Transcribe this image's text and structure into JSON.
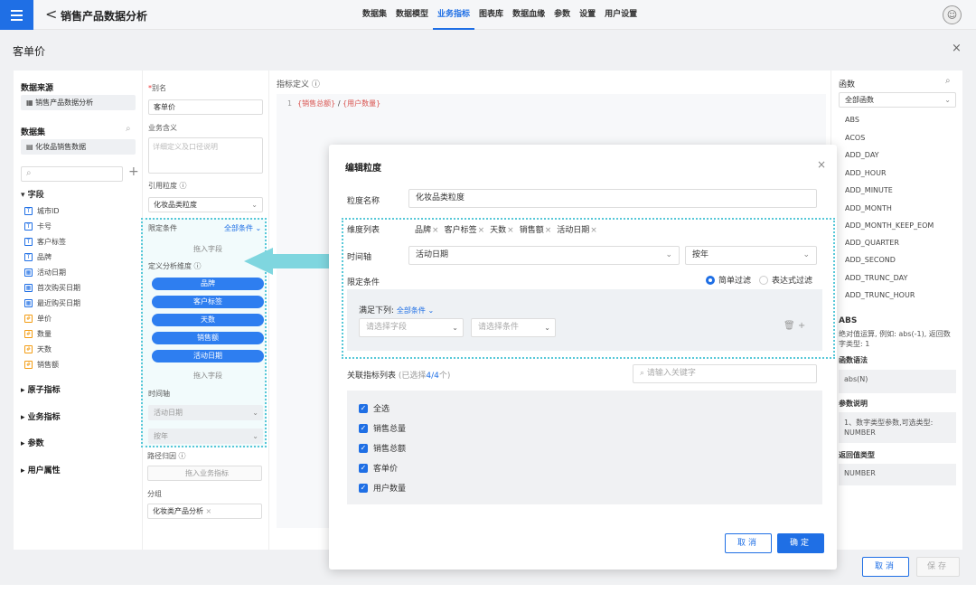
{
  "topbar": {
    "back": "<",
    "title": "销售产品数据分析",
    "nav": [
      "数据集",
      "数据模型",
      "业务指标",
      "图表库",
      "数据血缘",
      "参数",
      "设置",
      "用户设置"
    ],
    "active_nav": "业务指标",
    "avatar": "☺"
  },
  "dialog": {
    "title": "客单价",
    "close": "×"
  },
  "left": {
    "source_title": "数据来源",
    "source_value": "销售产品数据分析",
    "dataset_title": "数据集",
    "dataset_value": "化妆品销售数据",
    "fields_title": "字段",
    "fields": [
      "城市ID",
      "卡号",
      "客户标签",
      "品牌",
      "活动日期",
      "首次购买日期",
      "最近购买日期",
      "单价",
      "数量",
      "天数",
      "销售额"
    ],
    "groups": [
      "原子指标",
      "业务指标",
      "参数",
      "用户属性"
    ]
  },
  "mid": {
    "alias_label": "别名",
    "alias_value": "客单价",
    "meaning_label": "业务含义",
    "meaning_placeholder": "详细定义及口径说明",
    "granularity_label": "引用粒度",
    "granularity_value": "化妆品类粒度",
    "limit_label": "限定条件",
    "limit_link": "全部条件",
    "drop_hint": "拖入字段",
    "dims_label": "定义分析维度",
    "dims": [
      "品牌",
      "客户标签",
      "天数",
      "销售额",
      "活动日期"
    ],
    "drop_hint2": "拖入字段",
    "time_label": "时间轴",
    "time_value": "活动日期",
    "time_unit": "按年",
    "path_label": "路径归因",
    "path_hint": "拖入业务指标",
    "group_label": "分组",
    "group_value": "化妆类产品分析"
  },
  "editor": {
    "label": "指标定义",
    "line_no": "1",
    "expr_a": "{销售总额}",
    "expr_op": " / ",
    "expr_b": "{用户数量}"
  },
  "right": {
    "title": "函数",
    "select": "全部函数",
    "functions": [
      "ABS",
      "ACOS",
      "ADD_DAY",
      "ADD_HOUR",
      "ADD_MINUTE",
      "ADD_MONTH",
      "ADD_MONTH_KEEP_EOM",
      "ADD_QUARTER",
      "ADD_SECOND",
      "ADD_TRUNC_DAY",
      "ADD_TRUNC_HOUR"
    ],
    "fn_name": "ABS",
    "fn_desc": "绝对值运算, 例如: abs(-1), 返回数字类型: 1",
    "syntax_title": "函数语法",
    "syntax": "abs(N)",
    "param_title": "参数说明",
    "param": "1、数字类型参数,可选类型: NUMBER",
    "return_title": "返回值类型",
    "return": "NUMBER"
  },
  "footer": {
    "cancel": "取消",
    "save": "保存"
  },
  "modal": {
    "title": "编辑粒度",
    "close": "×",
    "name_label": "粒度名称",
    "name_value": "化妆品类粒度",
    "dim_label": "维度列表",
    "dims": [
      "品牌",
      "客户标签",
      "天数",
      "销售额",
      "活动日期"
    ],
    "time_label": "时间轴",
    "time_value": "活动日期",
    "time_unit": "按年",
    "limit_label": "限定条件",
    "radio_simple": "简单过滤",
    "radio_expr": "表达式过滤",
    "cond_label": "满足下列:",
    "cond_link": "全部条件",
    "field_placeholder": "请选择字段",
    "cond_placeholder": "请选择条件",
    "rel_label": "关联指标列表",
    "rel_count_pre": "(已选择",
    "rel_count": "4/4",
    "rel_count_post": "个)",
    "kw_placeholder": "请输入关键字",
    "checks": [
      "全选",
      "销售总量",
      "销售总额",
      "客单价",
      "用户数量"
    ],
    "cancel": "取消",
    "ok": "确定"
  },
  "colors": {
    "accent": "#1f6fe5",
    "highlight": "#57c8d8"
  }
}
